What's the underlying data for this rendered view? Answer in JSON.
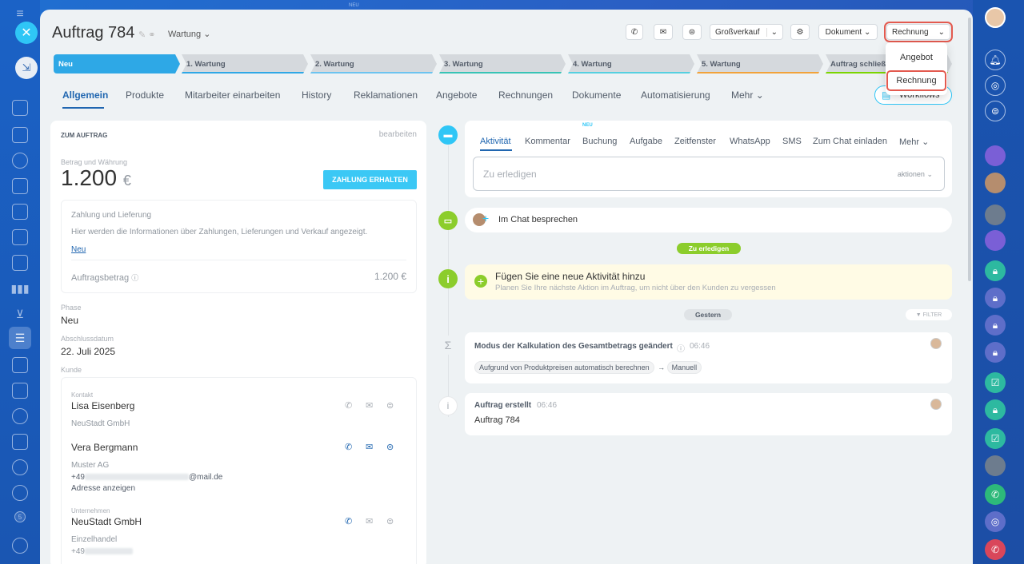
{
  "header": {
    "title": "Auftrag 784",
    "stage_selector": "Wartung",
    "funnel_selector": "Großverkauf",
    "document_button": "Dokument",
    "invoice_button": "Rechnung",
    "top_badge": "NEU"
  },
  "invoice_dropdown": {
    "items": [
      "Angebot",
      "Rechnung"
    ]
  },
  "stages": [
    {
      "label": "Neu",
      "color": "#2ea8e6"
    },
    {
      "label": "1. Wartung",
      "color": "#2ea8e6"
    },
    {
      "label": "2. Wartung",
      "color": "#6cc4f0"
    },
    {
      "label": "3. Wartung",
      "color": "#38c4b6"
    },
    {
      "label": "4. Wartung",
      "color": "#55d0e0"
    },
    {
      "label": "5. Wartung",
      "color": "#f2a33a"
    },
    {
      "label": "Auftrag schließen",
      "color": "#7bd500"
    }
  ],
  "tabs": [
    "Allgemein",
    "Produkte",
    "Mitarbeiter einarbeiten",
    "History",
    "Reklamationen",
    "Angebote",
    "Rechnungen",
    "Dokumente",
    "Automatisierung",
    "Mehr"
  ],
  "workflows_label": "Workflows",
  "order_panel": {
    "section_title": "ZUM AUFTRAG",
    "edit_label": "bearbeiten",
    "amount_label": "Betrag und Währung",
    "amount_value": "1.200",
    "currency": "€",
    "payment_button": "ZAHLUNG ERHALTEN",
    "payment_box_title": "Zahlung und Lieferung",
    "payment_box_text": "Hier werden die Informationen über Zahlungen, Lieferungen und Verkauf angezeigt.",
    "payment_box_link": "Neu",
    "order_amount_label": "Auftragsbetrag",
    "order_amount_value": "1.200 €",
    "phase_label": "Phase",
    "phase_value": "Neu",
    "close_date_label": "Abschlussdatum",
    "close_date_value": "22. Juli 2025",
    "client_label": "Kunde"
  },
  "client": {
    "contact_label": "Kontakt",
    "contact1_name": "Lisa Eisenberg",
    "contact1_company": "NeuStadt GmbH",
    "contact2_name": "Vera Bergmann",
    "contact2_company": "Muster AG",
    "contact2_phone_prefix": "+49",
    "contact2_email_suffix": "@mail.de",
    "show_address": "Adresse anzeigen",
    "company_label": "Unternehmen",
    "company_name": "NeuStadt GmbH",
    "company_industry": "Einzelhandel",
    "company_phone_prefix": "+49"
  },
  "activity": {
    "tabs": [
      "Aktivität",
      "Kommentar",
      "Buchung",
      "Aufgabe",
      "Zeitfenster",
      "WhatsApp",
      "SMS",
      "Zum Chat einladen",
      "Mehr"
    ],
    "new_badge": "NEU",
    "todo_placeholder": "Zu erledigen",
    "actions_label": "aktionen",
    "chat_label": "Im Chat besprechen"
  },
  "timeline": {
    "todo_chip": "Zu erledigen",
    "add_title": "Fügen Sie eine neue Aktivität hinzu",
    "add_sub": "Planen Sie Ihre nächste Aktion im Auftrag, um nicht über den Kunden zu vergessen",
    "yesterday_chip": "Gestern",
    "filter_label": "FILTER",
    "event1_title": "Modus der Kalkulation des Gesamtbetrags geändert",
    "event1_time": "06:46",
    "event1_from": "Aufgrund von Produktpreisen automatisch berechnen",
    "event1_to": "Manuell",
    "event2_title": "Auftrag erstellt",
    "event2_time": "06:46",
    "event2_body": "Auftrag 784"
  },
  "sidebar": {
    "counter": "5"
  }
}
